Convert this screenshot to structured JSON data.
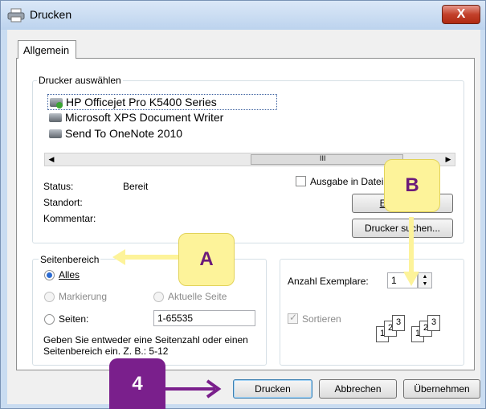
{
  "window": {
    "title": "Drucken",
    "close_label": "X"
  },
  "tab": {
    "label": "Allgemein"
  },
  "printer_group": {
    "label": "Drucker auswählen",
    "printers": [
      {
        "name": "HP Officejet Pro K5400 Series",
        "selected": true
      },
      {
        "name": "Microsoft XPS Document Writer",
        "selected": false
      },
      {
        "name": "Send To OneNote 2010",
        "selected": false
      }
    ],
    "scroll_thumb_label": "III"
  },
  "status": {
    "status_label": "Status:",
    "status_value": "Bereit",
    "location_label": "Standort:",
    "comment_label": "Kommentar:",
    "output_to_file_label": "Ausgabe in Datei",
    "preferences_button": "Einst",
    "find_printer_button": "Drucker suchen..."
  },
  "page_range": {
    "label": "Seitenbereich",
    "all_label": "Alles",
    "selection_label": "Markierung",
    "current_page_label": "Aktuelle Seite",
    "pages_label": "Seiten:",
    "pages_value": "1-65535",
    "hint": "Geben Sie entweder eine Seitenzahl oder einen Seitenbereich ein. Z. B.: 5-12"
  },
  "copies": {
    "count_label": "Anzahl Exemplare:",
    "count_value": "1",
    "collate_label": "Sortieren",
    "collate_checked": true
  },
  "footer": {
    "print_button": "Drucken",
    "cancel_button": "Abbrechen",
    "apply_button": "Übernehmen"
  },
  "annotations": {
    "a": "A",
    "b": "B",
    "step": "4"
  },
  "colors": {
    "arrow_yellow": "#fdf39a",
    "arrow_purple": "#7a1f8c",
    "title_bar": "#c9dcf1"
  }
}
